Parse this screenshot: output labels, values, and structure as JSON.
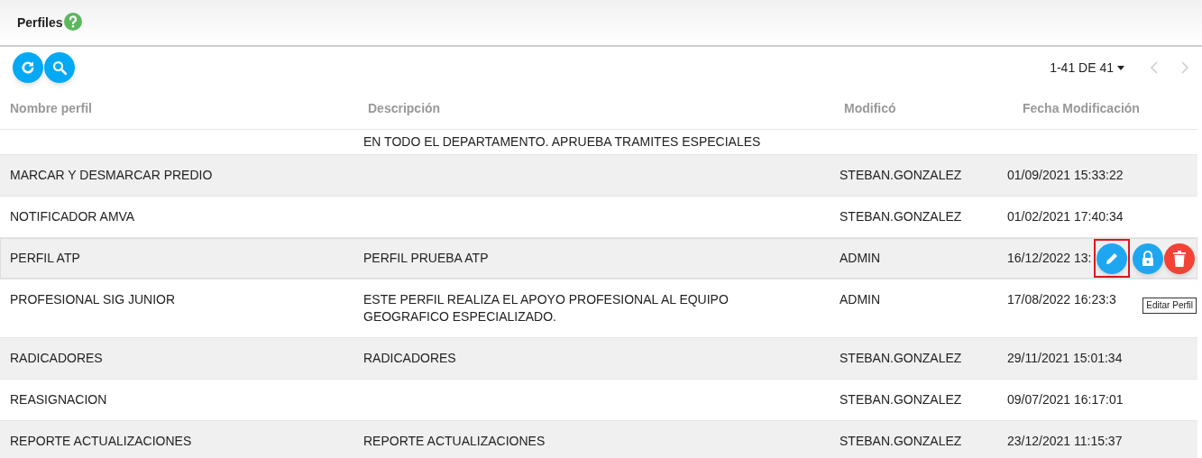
{
  "header": {
    "title": "Perfiles"
  },
  "toolbar": {
    "pagination": "1-41 DE 41"
  },
  "table": {
    "columns": [
      "Nombre perfil",
      "Descripción",
      "Modificó",
      "Fecha Modificación"
    ],
    "rows": [
      {
        "name": "",
        "description": "EN TODO EL DEPARTAMENTO. APRUEBA TRAMITES ESPECIALES",
        "modified_by": "",
        "date": "",
        "hovered": false
      },
      {
        "name": "MARCAR Y DESMARCAR PREDIO",
        "description": "",
        "modified_by": "STEBAN.GONZALEZ",
        "date": "01/09/2021 15:33:22",
        "hovered": false
      },
      {
        "name": "NOTIFICADOR AMVA",
        "description": "",
        "modified_by": "STEBAN.GONZALEZ",
        "date": "01/02/2021 17:40:34",
        "hovered": false
      },
      {
        "name": "PERFIL ATP",
        "description": "PERFIL PRUEBA ATP",
        "modified_by": "ADMIN",
        "date": "16/12/2022 13:",
        "hovered": true
      },
      {
        "name": "PROFESIONAL SIG JUNIOR",
        "description": "ESTE PERFIL REALIZA EL APOYO PROFESIONAL AL EQUIPO GEOGRAFICO ESPECIALIZADO.",
        "modified_by": "ADMIN",
        "date": "17/08/2022 16:23:3",
        "hovered": false
      },
      {
        "name": "RADICADORES",
        "description": "RADICADORES",
        "modified_by": "STEBAN.GONZALEZ",
        "date": "29/11/2021 15:01:34",
        "hovered": false
      },
      {
        "name": "REASIGNACION",
        "description": "",
        "modified_by": "STEBAN.GONZALEZ",
        "date": "09/07/2021 16:17:01",
        "hovered": false
      },
      {
        "name": "REPORTE ACTUALIZACIONES",
        "description": "REPORTE ACTUALIZACIONES",
        "modified_by": "STEBAN.GONZALEZ",
        "date": "23/12/2021 11:15:37",
        "hovered": false
      }
    ]
  },
  "tooltip": "Editar Perfil"
}
